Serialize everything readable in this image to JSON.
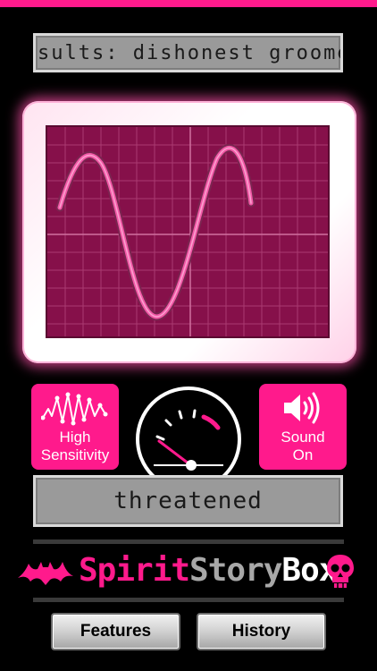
{
  "display": {
    "results_text": "sults: dishonest groome",
    "word_text": "threatened"
  },
  "controls": {
    "sensitivity_line1": "High",
    "sensitivity_line2": "Sensitivity",
    "sound_line1": "Sound",
    "sound_line2": "On"
  },
  "logo": {
    "part1": "Spirit",
    "part2": "Story",
    "part3": "Box"
  },
  "nav": {
    "features_label": "Features",
    "history_label": "History"
  },
  "colors": {
    "accent": "#ff1a8c",
    "screen": "#86104a",
    "lcd": "#9a9a9a"
  },
  "icons": {
    "sensitivity": "zigzag-wave-icon",
    "sound": "speaker-icon",
    "meter": "gauge-icon",
    "logo_left": "bat-icon",
    "logo_right": "skull-icon"
  }
}
